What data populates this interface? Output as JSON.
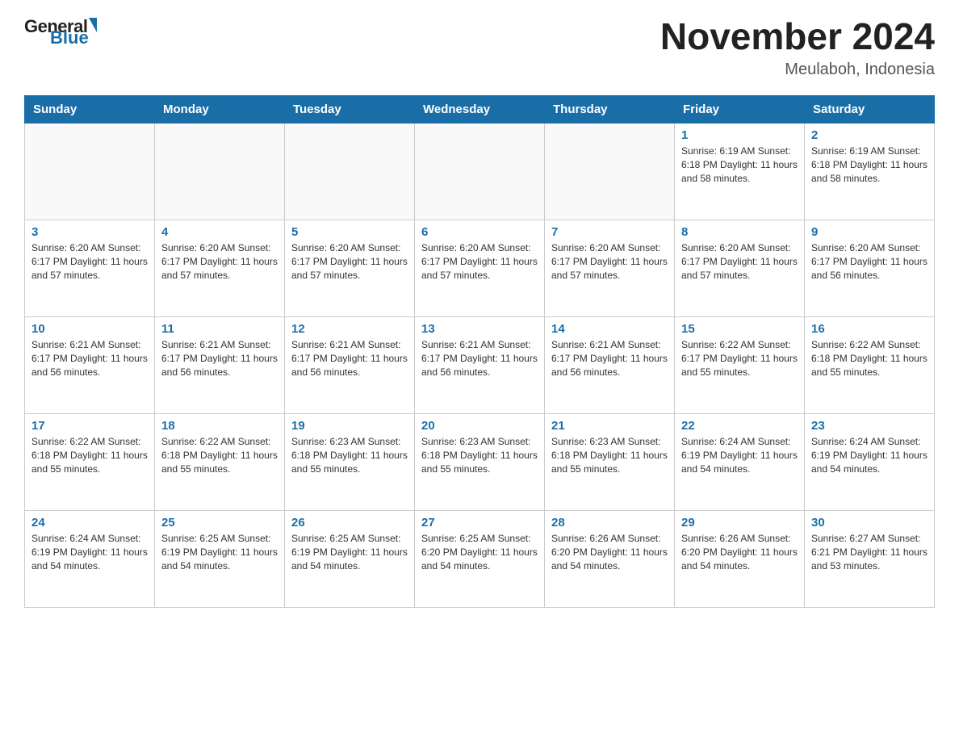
{
  "header": {
    "logo": {
      "general": "General",
      "blue": "Blue"
    },
    "title": "November 2024",
    "location": "Meulaboh, Indonesia"
  },
  "calendar": {
    "days_of_week": [
      "Sunday",
      "Monday",
      "Tuesday",
      "Wednesday",
      "Thursday",
      "Friday",
      "Saturday"
    ],
    "weeks": [
      [
        {
          "day": "",
          "info": ""
        },
        {
          "day": "",
          "info": ""
        },
        {
          "day": "",
          "info": ""
        },
        {
          "day": "",
          "info": ""
        },
        {
          "day": "",
          "info": ""
        },
        {
          "day": "1",
          "info": "Sunrise: 6:19 AM\nSunset: 6:18 PM\nDaylight: 11 hours\nand 58 minutes."
        },
        {
          "day": "2",
          "info": "Sunrise: 6:19 AM\nSunset: 6:18 PM\nDaylight: 11 hours\nand 58 minutes."
        }
      ],
      [
        {
          "day": "3",
          "info": "Sunrise: 6:20 AM\nSunset: 6:17 PM\nDaylight: 11 hours\nand 57 minutes."
        },
        {
          "day": "4",
          "info": "Sunrise: 6:20 AM\nSunset: 6:17 PM\nDaylight: 11 hours\nand 57 minutes."
        },
        {
          "day": "5",
          "info": "Sunrise: 6:20 AM\nSunset: 6:17 PM\nDaylight: 11 hours\nand 57 minutes."
        },
        {
          "day": "6",
          "info": "Sunrise: 6:20 AM\nSunset: 6:17 PM\nDaylight: 11 hours\nand 57 minutes."
        },
        {
          "day": "7",
          "info": "Sunrise: 6:20 AM\nSunset: 6:17 PM\nDaylight: 11 hours\nand 57 minutes."
        },
        {
          "day": "8",
          "info": "Sunrise: 6:20 AM\nSunset: 6:17 PM\nDaylight: 11 hours\nand 57 minutes."
        },
        {
          "day": "9",
          "info": "Sunrise: 6:20 AM\nSunset: 6:17 PM\nDaylight: 11 hours\nand 56 minutes."
        }
      ],
      [
        {
          "day": "10",
          "info": "Sunrise: 6:21 AM\nSunset: 6:17 PM\nDaylight: 11 hours\nand 56 minutes."
        },
        {
          "day": "11",
          "info": "Sunrise: 6:21 AM\nSunset: 6:17 PM\nDaylight: 11 hours\nand 56 minutes."
        },
        {
          "day": "12",
          "info": "Sunrise: 6:21 AM\nSunset: 6:17 PM\nDaylight: 11 hours\nand 56 minutes."
        },
        {
          "day": "13",
          "info": "Sunrise: 6:21 AM\nSunset: 6:17 PM\nDaylight: 11 hours\nand 56 minutes."
        },
        {
          "day": "14",
          "info": "Sunrise: 6:21 AM\nSunset: 6:17 PM\nDaylight: 11 hours\nand 56 minutes."
        },
        {
          "day": "15",
          "info": "Sunrise: 6:22 AM\nSunset: 6:17 PM\nDaylight: 11 hours\nand 55 minutes."
        },
        {
          "day": "16",
          "info": "Sunrise: 6:22 AM\nSunset: 6:18 PM\nDaylight: 11 hours\nand 55 minutes."
        }
      ],
      [
        {
          "day": "17",
          "info": "Sunrise: 6:22 AM\nSunset: 6:18 PM\nDaylight: 11 hours\nand 55 minutes."
        },
        {
          "day": "18",
          "info": "Sunrise: 6:22 AM\nSunset: 6:18 PM\nDaylight: 11 hours\nand 55 minutes."
        },
        {
          "day": "19",
          "info": "Sunrise: 6:23 AM\nSunset: 6:18 PM\nDaylight: 11 hours\nand 55 minutes."
        },
        {
          "day": "20",
          "info": "Sunrise: 6:23 AM\nSunset: 6:18 PM\nDaylight: 11 hours\nand 55 minutes."
        },
        {
          "day": "21",
          "info": "Sunrise: 6:23 AM\nSunset: 6:18 PM\nDaylight: 11 hours\nand 55 minutes."
        },
        {
          "day": "22",
          "info": "Sunrise: 6:24 AM\nSunset: 6:19 PM\nDaylight: 11 hours\nand 54 minutes."
        },
        {
          "day": "23",
          "info": "Sunrise: 6:24 AM\nSunset: 6:19 PM\nDaylight: 11 hours\nand 54 minutes."
        }
      ],
      [
        {
          "day": "24",
          "info": "Sunrise: 6:24 AM\nSunset: 6:19 PM\nDaylight: 11 hours\nand 54 minutes."
        },
        {
          "day": "25",
          "info": "Sunrise: 6:25 AM\nSunset: 6:19 PM\nDaylight: 11 hours\nand 54 minutes."
        },
        {
          "day": "26",
          "info": "Sunrise: 6:25 AM\nSunset: 6:19 PM\nDaylight: 11 hours\nand 54 minutes."
        },
        {
          "day": "27",
          "info": "Sunrise: 6:25 AM\nSunset: 6:20 PM\nDaylight: 11 hours\nand 54 minutes."
        },
        {
          "day": "28",
          "info": "Sunrise: 6:26 AM\nSunset: 6:20 PM\nDaylight: 11 hours\nand 54 minutes."
        },
        {
          "day": "29",
          "info": "Sunrise: 6:26 AM\nSunset: 6:20 PM\nDaylight: 11 hours\nand 54 minutes."
        },
        {
          "day": "30",
          "info": "Sunrise: 6:27 AM\nSunset: 6:21 PM\nDaylight: 11 hours\nand 53 minutes."
        }
      ]
    ]
  }
}
